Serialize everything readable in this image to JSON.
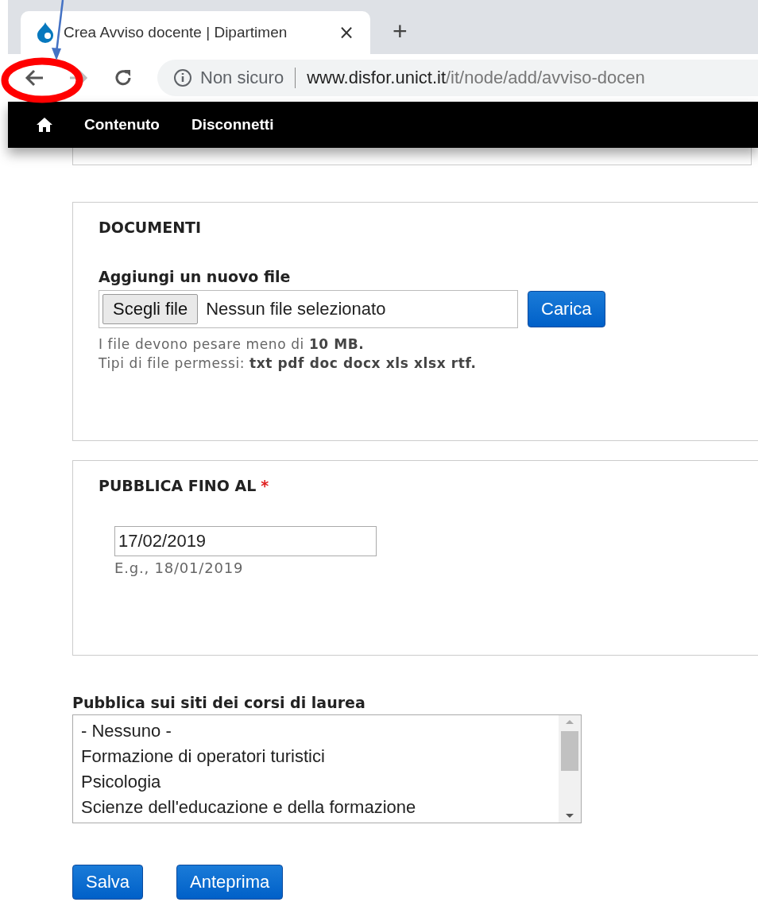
{
  "browser": {
    "tab": {
      "title": "Crea Avviso docente | Dipartimen",
      "close": "×"
    },
    "new_tab": "+",
    "security": "Non sicuro",
    "url_host": "www.disfor.unict.it",
    "url_path": "/it/node/add/avviso-docen"
  },
  "toolbar": {
    "items": [
      "Contenuto",
      "Disconnetti"
    ]
  },
  "documents": {
    "legend": "DOCUMENTI",
    "label": "Aggiungi un nuovo file",
    "choose_button": "Scegli file",
    "no_file": "Nessun file selezionato",
    "upload_button": "Carica",
    "help": [
      "I file devono pesare meno di **10 MB.**",
      "Tipi di file permessi: **txt pdf doc docx xls xlsx rtf.**"
    ]
  },
  "publish_until": {
    "legend": "PUBBLICA FINO AL",
    "required": "*",
    "value": "17/02/2019",
    "hint": "E.g., 18/01/2019"
  },
  "courses": {
    "label": "Pubblica sui siti dei corsi di laurea",
    "options": [
      {
        "label": "- Nessuno -",
        "selected": false
      },
      {
        "label": "Formazione di operatori turistici",
        "selected": false
      },
      {
        "label": "Psicologia",
        "selected": false
      },
      {
        "label": "Scienze dell'educazione e della formazione",
        "selected": false
      }
    ]
  },
  "buttons": [
    "Salva",
    "Anteprima"
  ],
  "annotations": [
    {
      "kind": "circle",
      "color": "#ff0000"
    },
    {
      "kind": "arrow",
      "color": "#4472c4"
    }
  ]
}
